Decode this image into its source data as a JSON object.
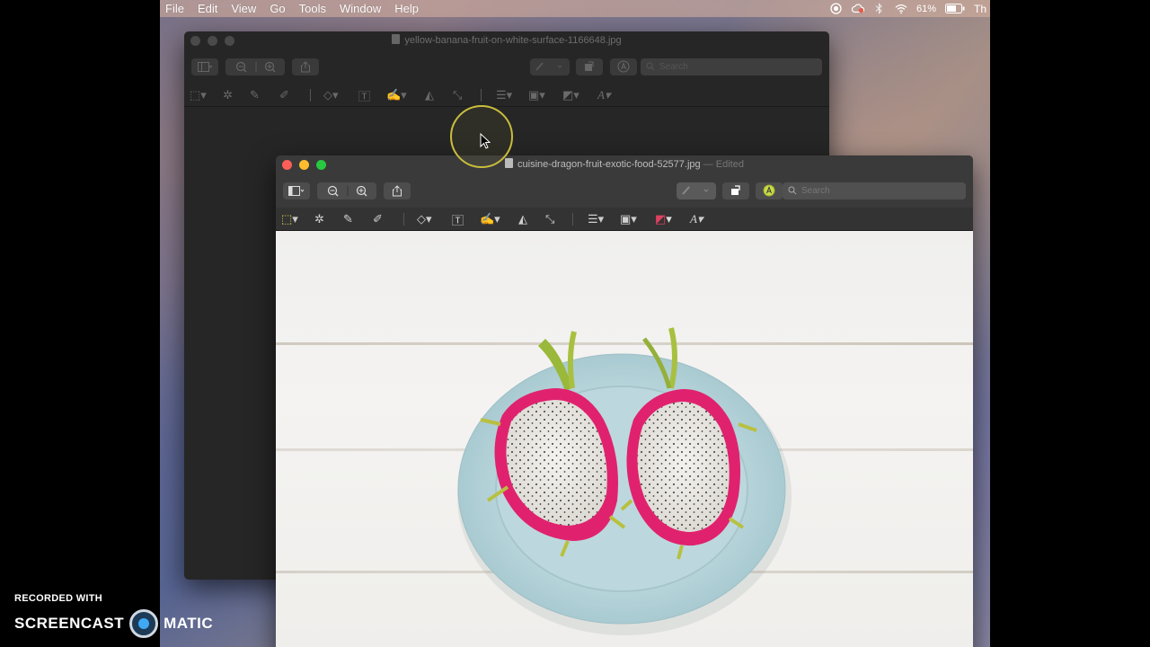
{
  "menubar": {
    "items": [
      "File",
      "Edit",
      "View",
      "Go",
      "Tools",
      "Window",
      "Help"
    ],
    "battery_percent": "61%",
    "clock_partial": "Th"
  },
  "back_window": {
    "title": "yellow-banana-fruit-on-white-surface-1166648.jpg",
    "search_placeholder": "Search"
  },
  "front_window": {
    "title": "cuisine-dragon-fruit-exotic-food-52577.jpg",
    "edited_suffix": "— Edited",
    "search_placeholder": "Search"
  },
  "watermark": {
    "line1": "RECORDED WITH",
    "brand_left": "SCREENCAST",
    "brand_right": "MATIC"
  },
  "icons": {
    "toolbar": [
      "sidebar-icon",
      "zoom-out-icon",
      "zoom-in-icon",
      "share-icon",
      "pen-icon",
      "rotate-icon",
      "markup-icon",
      "search-icon"
    ],
    "markup": [
      "selection-icon",
      "instant-alpha-icon",
      "sketch-icon",
      "draw-icon",
      "shapes-icon",
      "text-icon",
      "sign-icon",
      "adjust-color-icon",
      "adjust-size-icon",
      "shape-style-icon",
      "border-color-icon",
      "fill-color-icon",
      "text-style-icon"
    ]
  },
  "colors": {
    "close": "#fc5f57",
    "minimize": "#fdbc2e",
    "zoom": "#28c840",
    "cursor_ring": "#c8bd3c"
  }
}
